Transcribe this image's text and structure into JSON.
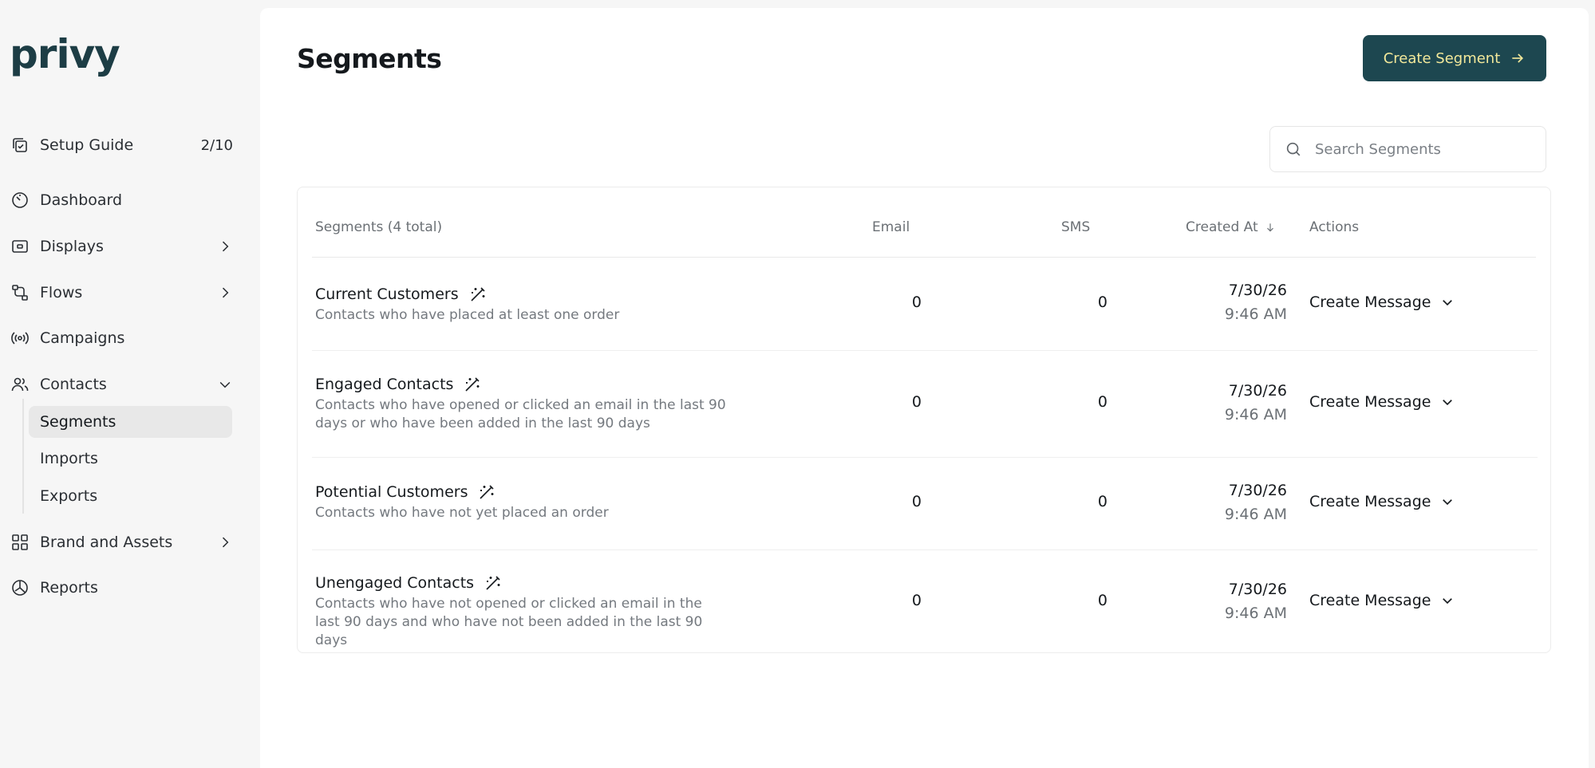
{
  "sidebar": {
    "logo": "privy",
    "items": [
      {
        "label": "Setup Guide",
        "icon": "setup-guide-icon",
        "badge": "2/10"
      },
      {
        "label": "Dashboard",
        "icon": "dashboard-icon"
      },
      {
        "label": "Displays",
        "icon": "displays-icon",
        "chevron": "chevron-right-icon"
      },
      {
        "label": "Flows",
        "icon": "flows-icon",
        "chevron": "chevron-right-icon"
      },
      {
        "label": "Campaigns",
        "icon": "campaigns-icon"
      },
      {
        "label": "Contacts",
        "icon": "contacts-icon",
        "chevron": "chevron-down-icon"
      },
      {
        "label": "Brand and Assets",
        "icon": "brand-assets-icon",
        "chevron": "chevron-right-icon"
      },
      {
        "label": "Reports",
        "icon": "reports-icon"
      }
    ],
    "contacts_sub": [
      {
        "label": "Segments",
        "active": true
      },
      {
        "label": "Imports"
      },
      {
        "label": "Exports"
      }
    ]
  },
  "main": {
    "title": "Segments",
    "create_button": "Create Segment",
    "search_placeholder": "Search Segments",
    "table": {
      "columns": {
        "segments": "Segments (4 total)",
        "email": "Email",
        "sms": "SMS",
        "created_at": "Created At",
        "actions": "Actions"
      },
      "rows": [
        {
          "name": "Current Customers",
          "desc": "Contacts who have placed at least one order",
          "email": "0",
          "sms": "0",
          "date": "7/30/26",
          "time": "9:46 AM",
          "action": "Create Message"
        },
        {
          "name": "Engaged Contacts",
          "desc": "Contacts who have opened or clicked an email in the last 90 days or who have been added in the last 90 days",
          "email": "0",
          "sms": "0",
          "date": "7/30/26",
          "time": "9:46 AM",
          "action": "Create Message"
        },
        {
          "name": "Potential Customers",
          "desc": "Contacts who have not yet placed an order",
          "email": "0",
          "sms": "0",
          "date": "7/30/26",
          "time": "9:46 AM",
          "action": "Create Message"
        },
        {
          "name": "Unengaged Contacts",
          "desc": "Contacts who have not opened or clicked an email in the last 90 days and who have not been added in the last 90 days",
          "email": "0",
          "sms": "0",
          "date": "7/30/26",
          "time": "9:46 AM",
          "action": "Create Message"
        }
      ]
    }
  },
  "colors": {
    "accent": "#1d4750",
    "accent_text": "#f2e89a",
    "logo": "#1d3d45"
  }
}
